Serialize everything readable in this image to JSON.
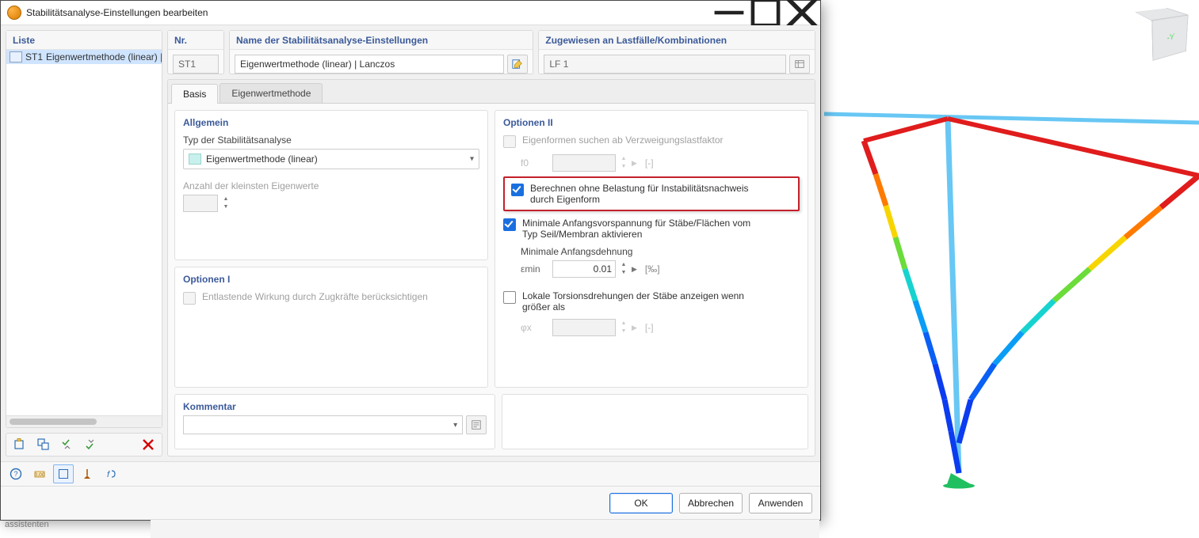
{
  "window": {
    "title": "Stabilitätsanalyse-Einstellungen bearbeiten"
  },
  "list": {
    "title": "Liste",
    "items": [
      {
        "code": "ST1",
        "label": "Eigenwertmethode (linear) | Lancz"
      }
    ]
  },
  "nr": {
    "title": "Nr.",
    "value": "ST1"
  },
  "name": {
    "title": "Name der Stabilitätsanalyse-Einstellungen",
    "value": "Eigenwertmethode (linear) | Lanczos"
  },
  "assigned": {
    "title": "Zugewiesen an Lastfälle/Kombinationen",
    "value": "LF 1"
  },
  "tabs": {
    "basis": "Basis",
    "eigen": "Eigenwertmethode"
  },
  "allgemein": {
    "title": "Allgemein",
    "typ_label": "Typ der Stabilitätsanalyse",
    "typ_value": "Eigenwertmethode (linear)",
    "anzahl_label": "Anzahl der kleinsten Eigenwerte",
    "anzahl_value": ""
  },
  "optionen1": {
    "title": "Optionen I",
    "chk1_label": "Entlastende Wirkung durch Zugkräfte berücksichtigen"
  },
  "optionen2": {
    "title": "Optionen II",
    "chk_eigenformen": "Eigenformen suchen ab Verzweigungslastfaktor",
    "f0_label": "f0",
    "f0_value": "",
    "f0_unit": "[-]",
    "chk_berechnen": "Berechnen ohne Belastung für Instabilitätsnachweis durch Eigenform",
    "chk_minvorspannung": "Minimale Anfangsvorspannung für Stäbe/Flächen vom Typ Seil/Membran aktivieren",
    "min_dehnung_label": "Minimale Anfangsdehnung",
    "emin_label": "εmin",
    "emin_value": "0.01",
    "emin_unit": "[‰]",
    "chk_torsion": "Lokale Torsionsdrehungen der Stäbe anzeigen wenn größer als",
    "phix_label": "φx",
    "phix_value": "",
    "phix_unit": "[-]"
  },
  "kommentar": {
    "title": "Kommentar",
    "value": ""
  },
  "buttons": {
    "ok": "OK",
    "cancel": "Abbrechen",
    "apply": "Anwenden"
  },
  "below": {
    "assistenten": "assistenten"
  }
}
